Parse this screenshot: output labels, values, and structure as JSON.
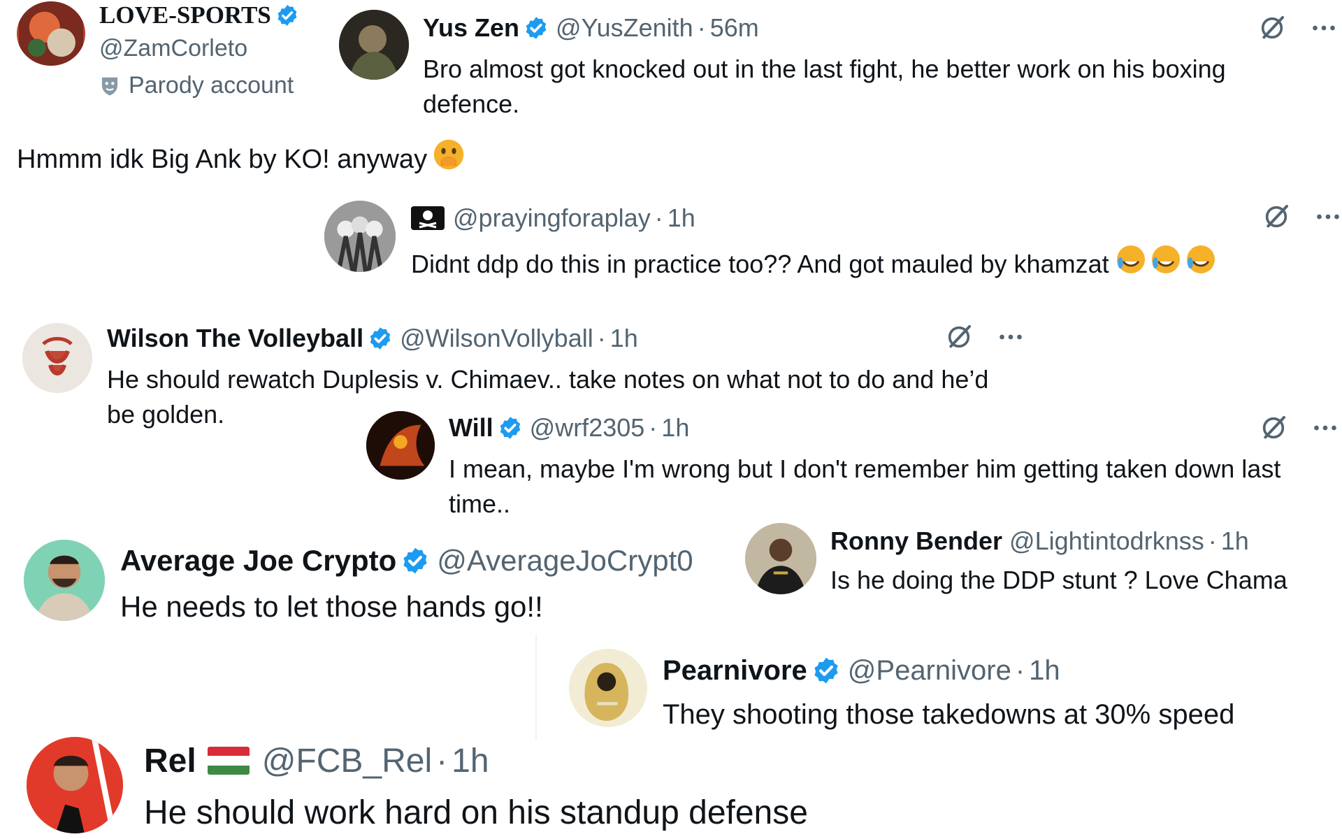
{
  "colors": {
    "verified": "#1d9bf0",
    "muted": "#536471",
    "text": "#0f1419"
  },
  "posts": [
    {
      "name": "LOVE-SPORTS",
      "handle": "@ZamCorleto",
      "parody": "Parody account",
      "text": "Hmmm idk Big Ank by KO! anyway",
      "emoji": "face-with-hand-over-mouth"
    },
    {
      "name": "Yus Zen",
      "handle": "@YusZenith",
      "time": "56m",
      "text": "Bro almost got knocked out in the last fight, he better work on his boxing defence."
    },
    {
      "handle": "@prayingforaplay",
      "time": "1h",
      "text": "Didnt ddp do this in practice too?? And got mauled by khamzat",
      "emoji": "rolling-on-floor-laughing"
    },
    {
      "name": "Wilson The Volleyball",
      "handle": "@WilsonVollyball",
      "time": "1h",
      "text": "He should rewatch Duplesis v. Chimaev.. take notes on what not to do and he’d be golden."
    },
    {
      "name": "Will",
      "handle": "@wrf2305",
      "time": "1h",
      "text": "I mean, maybe I'm wrong but I don't remember him getting taken down last time.."
    },
    {
      "name": "Average Joe Crypto",
      "handle": "@AverageJoCrypt0",
      "text": "He needs to let those hands go!!"
    },
    {
      "name": "Ronny Bender",
      "handle": "@Lightintodrknss",
      "time": "1h",
      "text": "Is he doing the DDP stunt ? Love Chama"
    },
    {
      "name": "Pearnivore",
      "handle": "@Pearnivore",
      "time": "1h",
      "text": "They shooting those takedowns at 30% speed"
    },
    {
      "name": "Rel",
      "handle": "@FCB_Rel",
      "time": "1h",
      "text": "He should work hard on his standup defense",
      "flag": "hungary"
    }
  ],
  "icons": {
    "verified": "verified-badge-icon",
    "grok": "grok-icon",
    "more": "more-options-icon",
    "parody": "parody-mask-icon"
  }
}
